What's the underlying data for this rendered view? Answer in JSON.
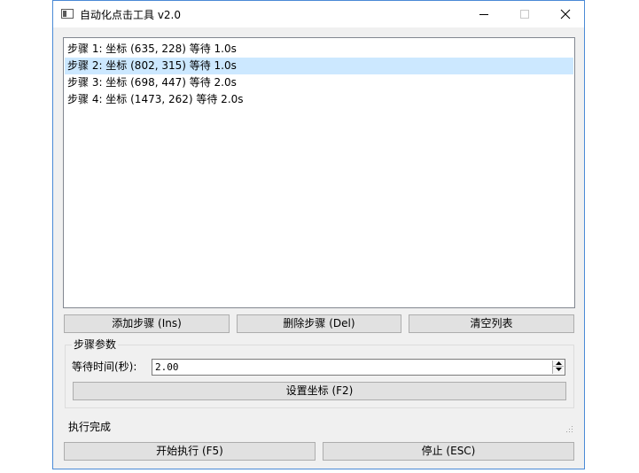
{
  "window": {
    "title": "自动化点击工具 v2.0",
    "controls": {
      "minimize": "minimize-icon",
      "maximize": "maximize-icon",
      "close": "close-icon"
    }
  },
  "steps": [
    "步骤 1: 坐标 (635, 228) 等待 1.0s",
    "步骤 2: 坐标 (802, 315) 等待 1.0s",
    "步骤 3: 坐标 (698, 447) 等待 2.0s",
    "步骤 4: 坐标 (1473, 262) 等待 2.0s"
  ],
  "selected_step_index": 1,
  "list_buttons": {
    "add": "添加步骤 (Ins)",
    "delete": "删除步骤 (Del)",
    "clear": "清空列表"
  },
  "params": {
    "group_title": "步骤参数",
    "wait_label": "等待时间(秒):",
    "wait_value": "2.00",
    "set_coord_button": "设置坐标 (F2)"
  },
  "status": "执行完成",
  "run_buttons": {
    "start": "开始执行 (F5)",
    "stop": "停止 (ESC)"
  },
  "colors": {
    "selection": "#cce8ff",
    "window_border": "#4a8ad6",
    "button_face": "#e1e1e1"
  }
}
